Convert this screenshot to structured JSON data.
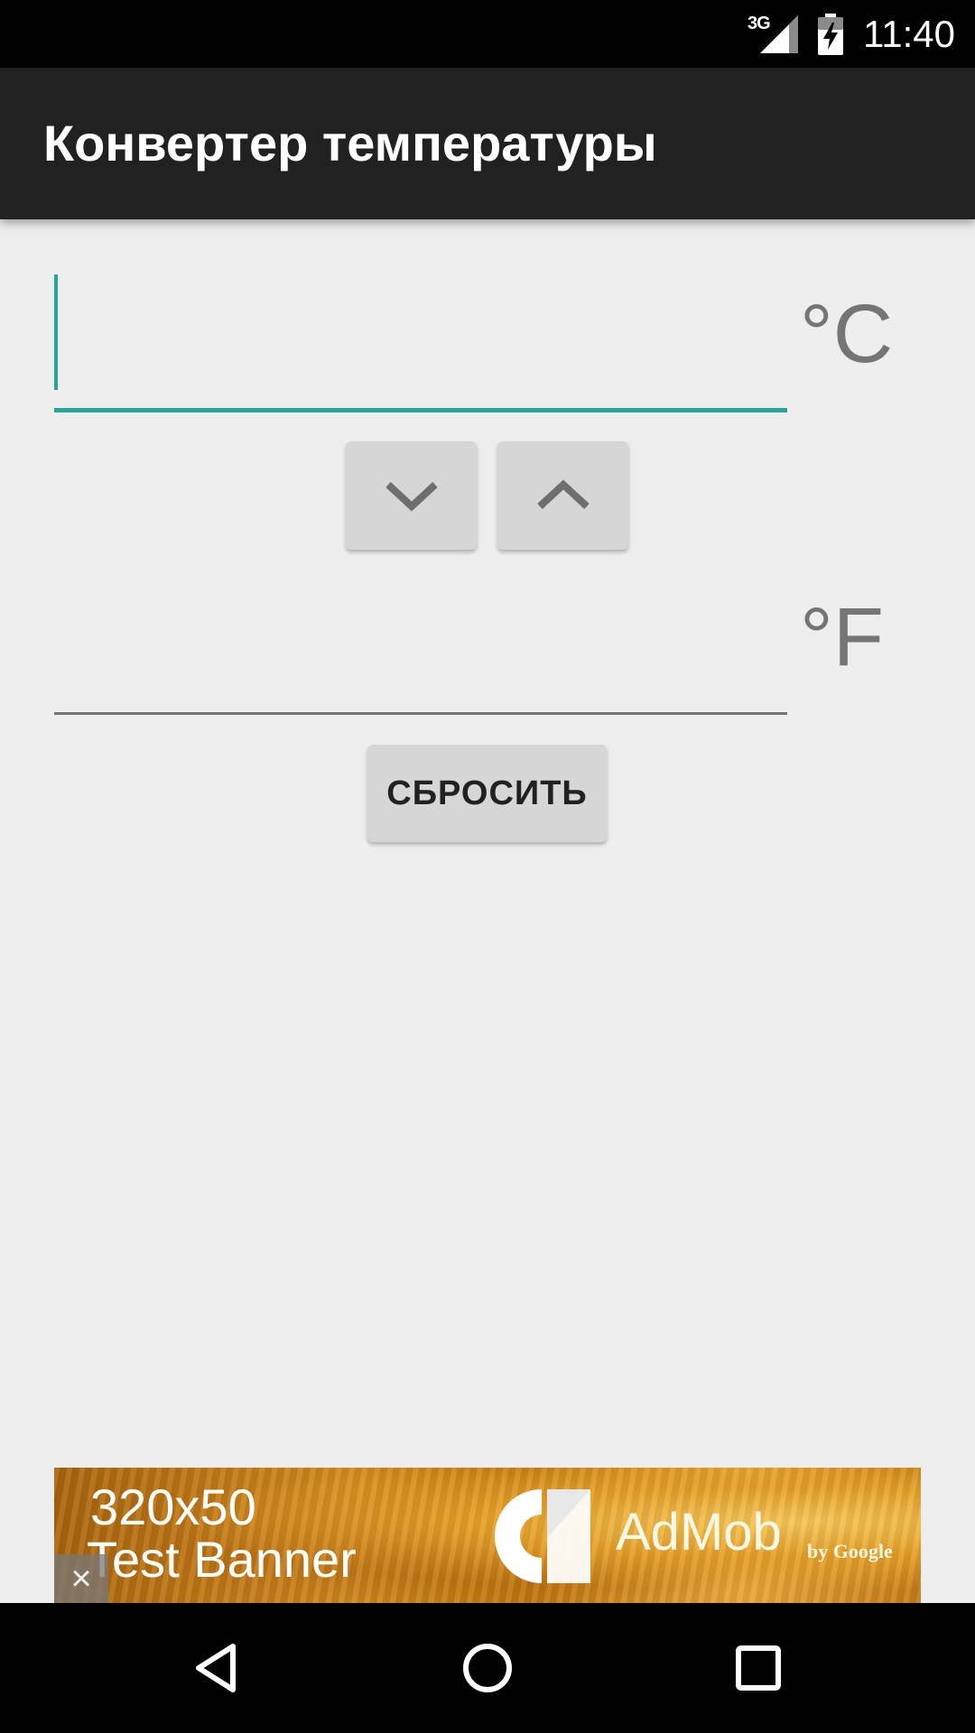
{
  "status_bar": {
    "network": "3G",
    "time": "11:40",
    "icons": [
      "signal-icon",
      "battery-charging-icon"
    ]
  },
  "app_bar": {
    "title": "Конвертер температуры"
  },
  "celsius": {
    "value": "",
    "unit": "°C",
    "focused": true,
    "accent": "#26a69a"
  },
  "stepper": {
    "down_icon": "chevron-down-icon",
    "up_icon": "chevron-up-icon"
  },
  "fahrenheit": {
    "value": "",
    "unit": "°F"
  },
  "reset_button": {
    "label": "СБРОСИТЬ"
  },
  "ad_banner": {
    "size_text": "320x50",
    "label": "Test Banner",
    "brand": "AdMob",
    "by": "by Google",
    "close": "×"
  },
  "nav_bar": {
    "icons": [
      "back-icon",
      "home-icon",
      "recents-icon"
    ]
  },
  "colors": {
    "background": "#eeeeee",
    "app_bar": "#212121",
    "accent": "#26a69a",
    "button": "#d6d6d6",
    "unit_text": "#757575"
  }
}
